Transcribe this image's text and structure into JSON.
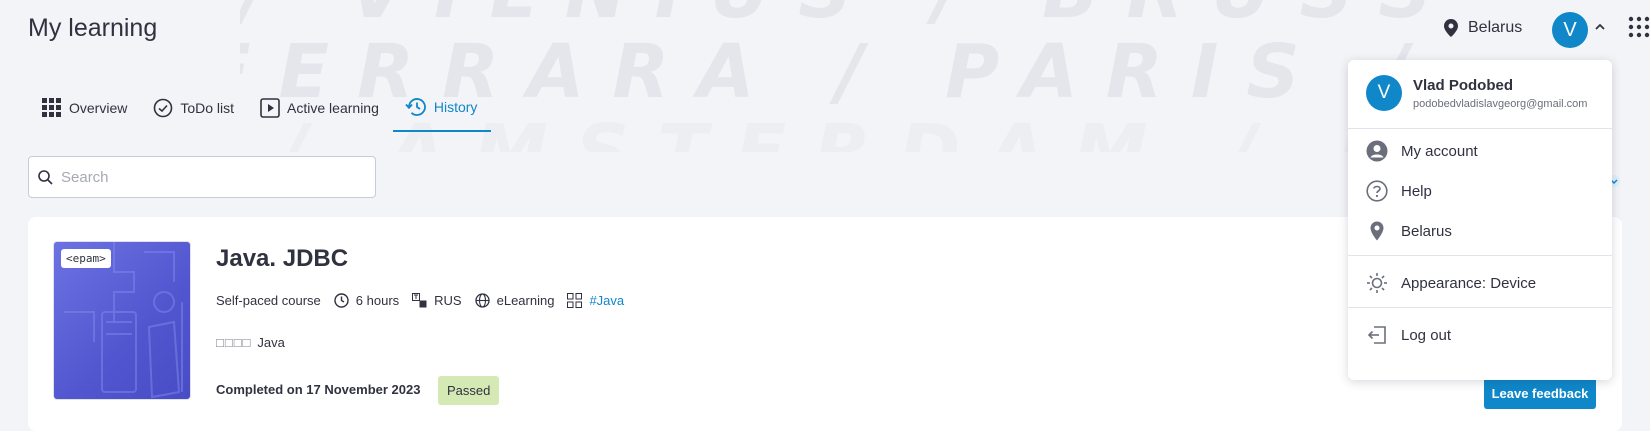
{
  "background": {
    "row1": "/ VILNIUS / BRUSSELS / DUBLIN / POTSDAM",
    "row2": "FERRARA / PARIS / ROME / OSLO / FERRARA",
    "row3": "/ AMSTERDAM / KRAKOW / TOKYO"
  },
  "header": {
    "title": "My learning",
    "location": "Belarus",
    "avatar_initial": "V"
  },
  "tabs": [
    {
      "label": "Overview",
      "icon": "grid-icon"
    },
    {
      "label": "ToDo list",
      "icon": "check-circle-icon"
    },
    {
      "label": "Active learning",
      "icon": "play-icon"
    },
    {
      "label": "History",
      "icon": "history-icon",
      "active": true
    }
  ],
  "search": {
    "placeholder": "Search",
    "value": ""
  },
  "course": {
    "logo": "<epam>",
    "title": "Java. JDBC",
    "type": "Self-paced course",
    "duration": "6 hours",
    "language": "RUS",
    "format": "eLearning",
    "tag": "#Java",
    "author_glyphs": "□□□□",
    "author_text": "Java",
    "completed": "Completed on 17 November 2023",
    "status": "Passed",
    "feedback_label": "Leave feedback"
  },
  "user_menu": {
    "name": "Vlad Podobed",
    "email": "podobedvladislavgeorg@gmail.com",
    "initial": "V",
    "items": {
      "account": "My account",
      "help": "Help",
      "location": "Belarus",
      "appearance": "Appearance: Device",
      "logout": "Log out"
    }
  },
  "colors": {
    "accent": "#0f87c9",
    "passed_badge": "#d5e9b4",
    "background": "#f3f4f7"
  }
}
